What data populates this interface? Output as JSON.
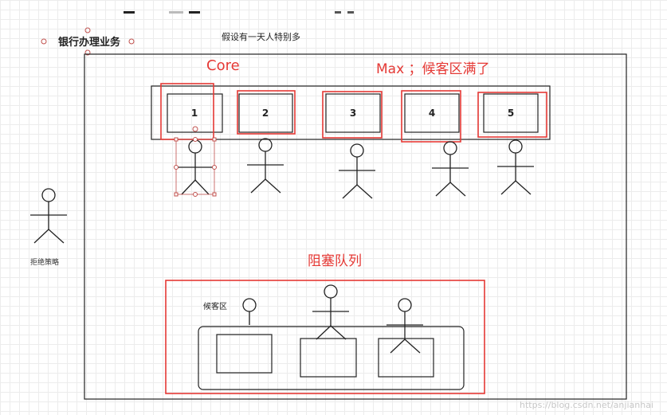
{
  "diagram": {
    "title": "银行办理业务",
    "note": "假设有一天人特别多",
    "core_label": "Core",
    "max_label": "Max ；候客区满了",
    "reject_label": "拒绝策略",
    "queue_label": "阻塞队列",
    "waiting_area_label": "候客区",
    "counters": [
      "1",
      "2",
      "3",
      "4",
      "5"
    ],
    "watermark": "https://blog.csdn.net/anjianhai",
    "colors": {
      "accent_red": "#e53935",
      "line": "#222222",
      "selection": "#c0504d"
    }
  }
}
